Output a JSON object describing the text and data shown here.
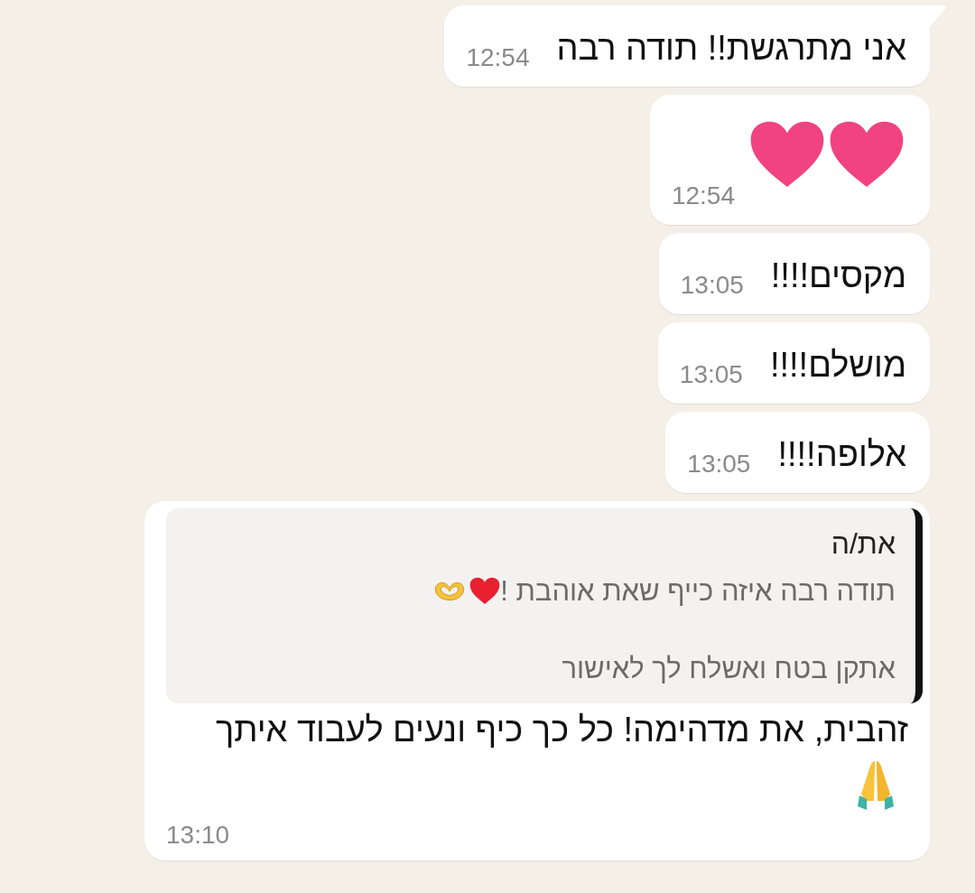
{
  "messages": [
    {
      "kind": "text",
      "text": "אני מתרגשת!! תודה רבה",
      "time": "12:54",
      "tail": true
    },
    {
      "kind": "hearts",
      "time": "12:54",
      "tail": false
    },
    {
      "kind": "text",
      "text": "מקסים!!!!",
      "time": "13:05",
      "tail": false
    },
    {
      "kind": "text",
      "text": "מושלם!!!!",
      "time": "13:05",
      "tail": false
    },
    {
      "kind": "text",
      "text": "אלופה!!!!",
      "time": "13:05",
      "tail": false
    },
    {
      "kind": "reply",
      "quote": {
        "author": "את/ה",
        "lines": [
          "תודה רבה איזה כייף שאת אוהבת !",
          "אתקן בטח ואשלח לך לאישור"
        ]
      },
      "text": "זהבית, את מדהימה! כל כך כיף ונעים לעבוד איתך",
      "time": "13:10",
      "tail": false
    }
  ]
}
